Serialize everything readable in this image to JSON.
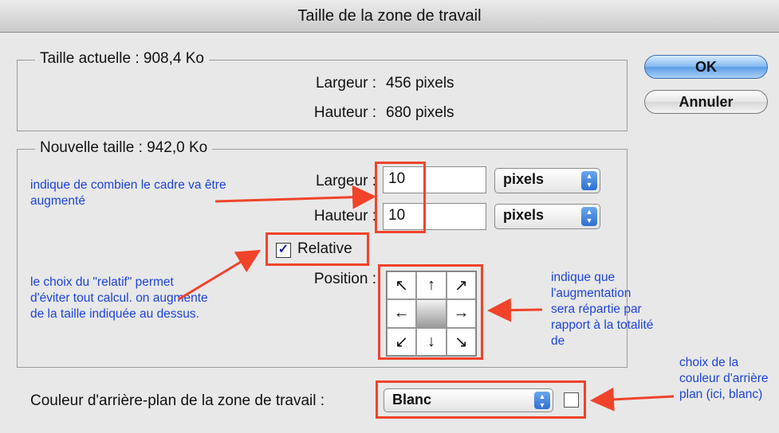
{
  "window": {
    "title": "Taille de la zone de travail"
  },
  "buttons": {
    "ok": "OK",
    "cancel": "Annuler"
  },
  "current": {
    "legend": "Taille actuelle : 908,4 Ko",
    "width_label": "Largeur :",
    "width_value": "456 pixels",
    "height_label": "Hauteur :",
    "height_value": "680 pixels"
  },
  "new_size": {
    "legend": "Nouvelle taille : 942,0 Ko",
    "width_label": "Largeur :",
    "width_value": "10",
    "width_unit": "pixels",
    "height_label": "Hauteur :",
    "height_value": "10",
    "height_unit": "pixels",
    "relative_label": "Relative",
    "relative_checked": true,
    "position_label": "Position :"
  },
  "background": {
    "label": "Couleur d'arrière-plan de la zone de travail :",
    "value": "Blanc",
    "swatch_color": "#ffffff"
  },
  "anchor_arrows": [
    "↖",
    "↑",
    "↗",
    "←",
    "",
    "→",
    "↙",
    "↓",
    "↘"
  ],
  "annotations": {
    "note1": "indique de combien le cadre va être augmenté",
    "note2": "le choix du \"relatif\" permet d'éviter tout calcul. on augmente de la taille indiquée au dessus.",
    "note3": "indique que l'augmentation sera répartie par rapport à la totalité de",
    "note4": "choix de la couleur d'arrière plan (ici, blanc)",
    "accent_color": "#f0432a",
    "text_color": "#1d43d8"
  }
}
